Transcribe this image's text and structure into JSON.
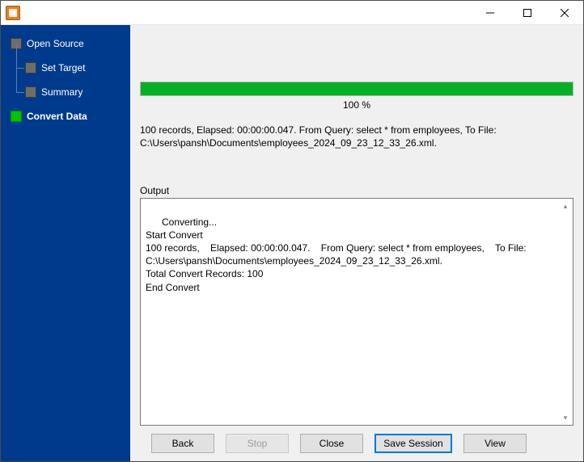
{
  "window": {
    "title": ""
  },
  "sidebar": {
    "items": [
      {
        "label": "Open Source"
      },
      {
        "label": "Set Target"
      },
      {
        "label": "Summary"
      },
      {
        "label": "Convert Data"
      }
    ]
  },
  "progress": {
    "percent_text": "100 %",
    "fill_percent": 100
  },
  "summary": "100 records,    Elapsed: 00:00:00.047.    From Query: select * from employees,    To File: C:\\Users\\pansh\\Documents\\employees_2024_09_23_12_33_26.xml.",
  "output": {
    "label": "Output",
    "text": "Converting...\nStart Convert\n100 records,    Elapsed: 00:00:00.047.    From Query: select * from employees,    To File: C:\\Users\\pansh\\Documents\\employees_2024_09_23_12_33_26.xml.\nTotal Convert Records: 100\nEnd Convert"
  },
  "buttons": {
    "back": "Back",
    "stop": "Stop",
    "close": "Close",
    "save_session": "Save Session",
    "view": "View"
  }
}
